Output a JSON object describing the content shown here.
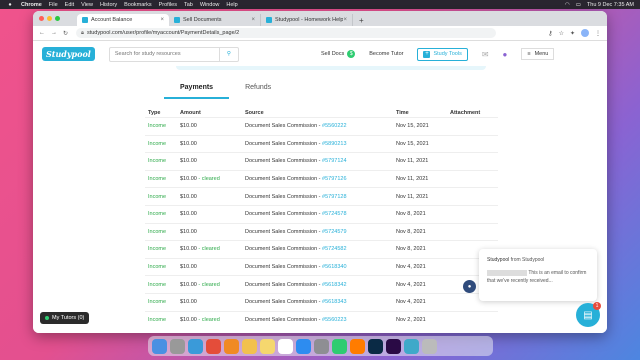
{
  "menubar": {
    "app": "Chrome",
    "items": [
      "File",
      "Edit",
      "View",
      "History",
      "Bookmarks",
      "Profiles",
      "Tab",
      "Window",
      "Help"
    ],
    "clock": "Thu 9 Dec  7:35 AM"
  },
  "tabs": [
    {
      "title": "Account Balance",
      "color": "#27b0d8",
      "active": true
    },
    {
      "title": "Sell Documents",
      "color": "#27b0d8",
      "active": false
    },
    {
      "title": "Studypool - Homework Help",
      "color": "#27b0d8",
      "active": false
    }
  ],
  "address": "studypool.com/user/profile/myaccount/PaymentDetails_page/2",
  "site": {
    "logo": "Studypool",
    "search_placeholder": "Search for study resources",
    "nav": {
      "sell_docs": "Sell Docs",
      "sell_docs_count": "$",
      "become_tutor": "Become Tutor",
      "study_tools": "Study Tools",
      "menu": "Menu"
    }
  },
  "subtabs": [
    {
      "label": "Payments",
      "active": true
    },
    {
      "label": "Refunds",
      "active": false
    }
  ],
  "table": {
    "headers": [
      "Type",
      "Amount",
      "Source",
      "Time",
      "Attachment"
    ],
    "rows": [
      {
        "type": "Income",
        "amount": "$10.00",
        "cleared": "",
        "source": "Document Sales Commission - ",
        "ref": "#5560222",
        "time": "Nov 15, 2021"
      },
      {
        "type": "Income",
        "amount": "$10.00",
        "cleared": "",
        "source": "Document Sales Commission - ",
        "ref": "#5890213",
        "time": "Nov 15, 2021"
      },
      {
        "type": "Income",
        "amount": "$10.00",
        "cleared": "",
        "source": "Document Sales Commission - ",
        "ref": "#5797124",
        "time": "Nov 11, 2021"
      },
      {
        "type": "Income",
        "amount": "$10.00",
        "cleared": " - cleared",
        "source": "Document Sales Commission - ",
        "ref": "#5797126",
        "time": "Nov 11, 2021"
      },
      {
        "type": "Income",
        "amount": "$10.00",
        "cleared": "",
        "source": "Document Sales Commission - ",
        "ref": "#5797128",
        "time": "Nov 11, 2021"
      },
      {
        "type": "Income",
        "amount": "$10.00",
        "cleared": "",
        "source": "Document Sales Commission - ",
        "ref": "#5724578",
        "time": "Nov 8, 2021"
      },
      {
        "type": "Income",
        "amount": "$10.00",
        "cleared": "",
        "source": "Document Sales Commission - ",
        "ref": "#5724579",
        "time": "Nov 8, 2021"
      },
      {
        "type": "Income",
        "amount": "$10.00",
        "cleared": " - cleared",
        "source": "Document Sales Commission - ",
        "ref": "#5724582",
        "time": "Nov 8, 2021"
      },
      {
        "type": "Income",
        "amount": "$10.00",
        "cleared": "",
        "source": "Document Sales Commission - ",
        "ref": "#5618340",
        "time": "Nov 4, 2021"
      },
      {
        "type": "Income",
        "amount": "$10.00",
        "cleared": " - cleared",
        "source": "Document Sales Commission - ",
        "ref": "#5618342",
        "time": "Nov 4, 2021"
      },
      {
        "type": "Income",
        "amount": "$10.00",
        "cleared": "",
        "source": "Document Sales Commission - ",
        "ref": "#5618343",
        "time": "Nov 4, 2021"
      },
      {
        "type": "Income",
        "amount": "$10.00",
        "cleared": " - cleared",
        "source": "Document Sales Commission - ",
        "ref": "#5560223",
        "time": "Nov 2, 2021"
      }
    ]
  },
  "popup": {
    "from_name": "Studypool",
    "from_suffix": " from Studypool",
    "message_visible": "This is an email to confirm that we've recently received..."
  },
  "my_tutors": "My Tutors (0)",
  "chat_badge": "1",
  "dock": [
    {
      "name": "finder-icon",
      "color": "#4a90e2"
    },
    {
      "name": "launchpad-icon",
      "color": "#999999"
    },
    {
      "name": "safari-icon",
      "color": "#3a9ad9"
    },
    {
      "name": "chrome-icon",
      "color": "#e44d3a"
    },
    {
      "name": "vlc-icon",
      "color": "#f08a24"
    },
    {
      "name": "photos-icon",
      "color": "#f2c14e"
    },
    {
      "name": "notes-icon",
      "color": "#f5d76e"
    },
    {
      "name": "calendar-icon",
      "color": "#ffffff"
    },
    {
      "name": "appstore-icon",
      "color": "#2d8cf0"
    },
    {
      "name": "settings-icon",
      "color": "#8e8e93"
    },
    {
      "name": "numbers-icon",
      "color": "#2ecc71"
    },
    {
      "name": "illustrator-icon",
      "color": "#ff7c00"
    },
    {
      "name": "photoshop-icon",
      "color": "#0a2a45"
    },
    {
      "name": "premiere-icon",
      "color": "#2a0a45"
    },
    {
      "name": "screen-recorder-icon",
      "color": "#3fa9c9"
    },
    {
      "name": "trash-icon",
      "color": "#bbbbbb"
    }
  ]
}
